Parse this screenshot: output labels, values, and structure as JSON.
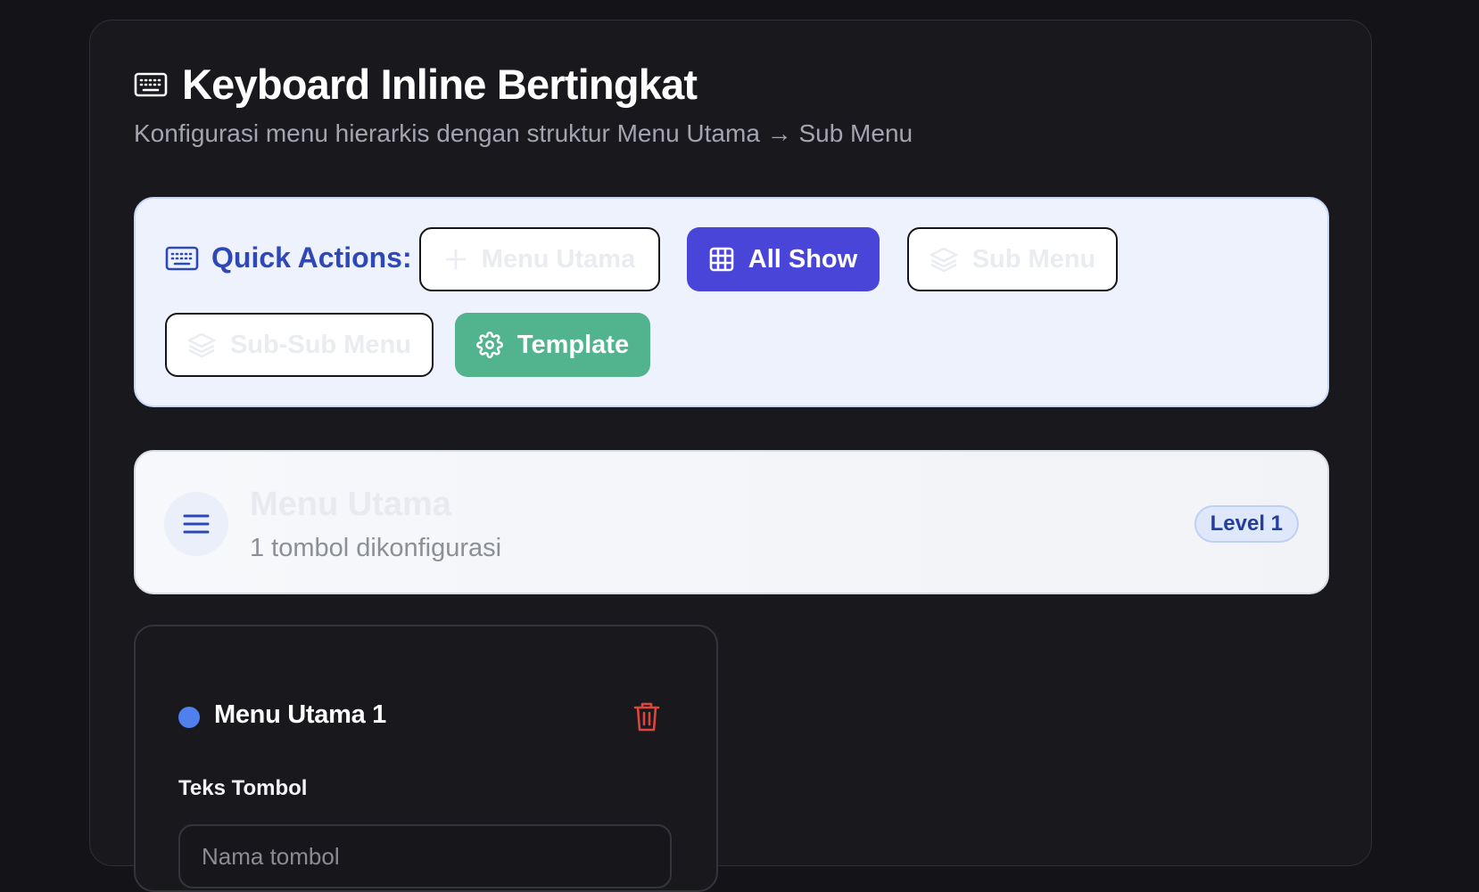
{
  "header": {
    "title": "Keyboard Inline Bertingkat",
    "subtitle": "Konfigurasi menu hierarkis dengan struktur Menu Utama → Sub Menu",
    "icon": "keyboard-icon"
  },
  "quick_actions": {
    "label": "Quick Actions:",
    "icon": "keyboard-icon",
    "buttons": [
      {
        "label": "Menu Utama",
        "icon": "plus-icon",
        "style": "outline"
      },
      {
        "label": "All Show",
        "icon": "grid-icon",
        "style": "primary"
      },
      {
        "label": "Sub Menu",
        "icon": "layers-icon",
        "style": "outline"
      },
      {
        "label": "Sub-Sub Menu",
        "icon": "layers-icon",
        "style": "outline"
      },
      {
        "label": "Template",
        "icon": "gear-icon",
        "style": "green"
      }
    ]
  },
  "menu_section": {
    "title": "Menu Utama",
    "subtitle": "1 tombol dikonfigurasi",
    "badge": "Level 1",
    "icon": "hamburger-menu-icon"
  },
  "menu_items": [
    {
      "title": "Menu Utama 1",
      "dot_color": "#4f80ee",
      "field_label": "Teks Tombol",
      "input_placeholder": "Nama tombol",
      "input_value": ""
    }
  ],
  "colors": {
    "background": "#131318",
    "accent_primary": "#4a45d9",
    "accent_green": "#51b48e",
    "quick_actions_text": "#2f48b8",
    "danger": "#e0453d"
  }
}
